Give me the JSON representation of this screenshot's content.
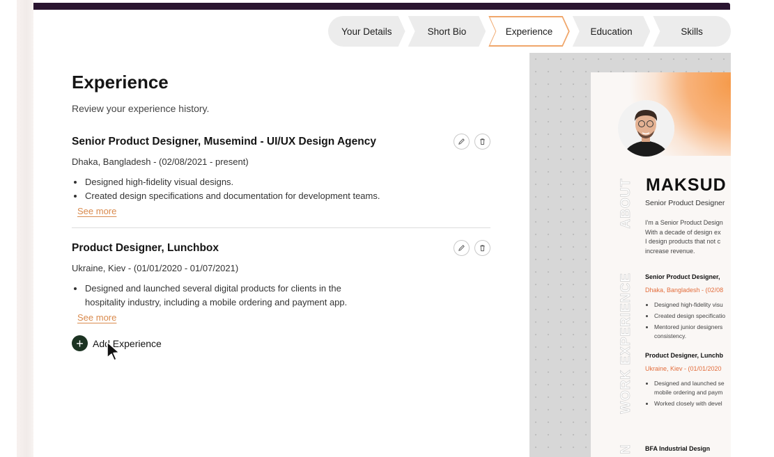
{
  "stepper": {
    "steps": [
      "Your Details",
      "Short Bio",
      "Experience",
      "Education",
      "Skills"
    ],
    "active_index": 2
  },
  "page": {
    "title": "Experience",
    "subtitle": "Review your experience history."
  },
  "experience": [
    {
      "title": "Senior Product Designer, Musemind - UI/UX Design Agency",
      "meta": "Dhaka, Bangladesh - (02/08/2021 - present)",
      "bullets": [
        "Designed high-fidelity visual designs.",
        "Created design specifications and documentation for development teams."
      ],
      "see_more": "See more"
    },
    {
      "title": "Product Designer, Lunchbox",
      "meta": "Ukraine, Kiev - (01/01/2020 - 01/07/2021)",
      "bullets": [
        "Designed and launched several digital products for clients in the",
        "hospitality industry, including a mobile ordering and payment app."
      ],
      "see_more": "See more"
    }
  ],
  "add_experience": {
    "icon": "+",
    "label": "Add Experience"
  },
  "resume_preview": {
    "name": "MAKSUD",
    "role": "Senior Product Designer",
    "section_about": "ABOUT",
    "about_lines": [
      "I'm a Senior Product Design",
      "With a decade of design ex",
      "I design products that not c",
      "increase revenue."
    ],
    "section_work": "WORK EXPERIENCE",
    "section_education": "N",
    "jobs": [
      {
        "title": "Senior Product Designer,",
        "meta": "Dhaka, Bangladesh - (02/08",
        "bullets": [
          "Designed high-fidelity visu",
          "Created design specificatio",
          "Mentored junior designers"
        ],
        "bullet_continuation": "consistency."
      },
      {
        "title": "Product Designer, Lunchb",
        "meta": "Ukraine, Kiev - (01/01/2020",
        "bullets": [
          "Designed and launched se",
          "Worked closely with devel"
        ],
        "bullet_continuation": "mobile ordering and paym"
      }
    ],
    "education_school": "BFA Industrial Design"
  },
  "colors": {
    "accent_orange": "#f0a66a",
    "link_orange": "#d98a4d",
    "resume_accent": "#e36d3c",
    "dark_green": "#1c3322",
    "window_strip": "#2a1530"
  },
  "icons": [
    "edit-icon",
    "delete-icon",
    "plus-icon",
    "cursor-icon"
  ]
}
